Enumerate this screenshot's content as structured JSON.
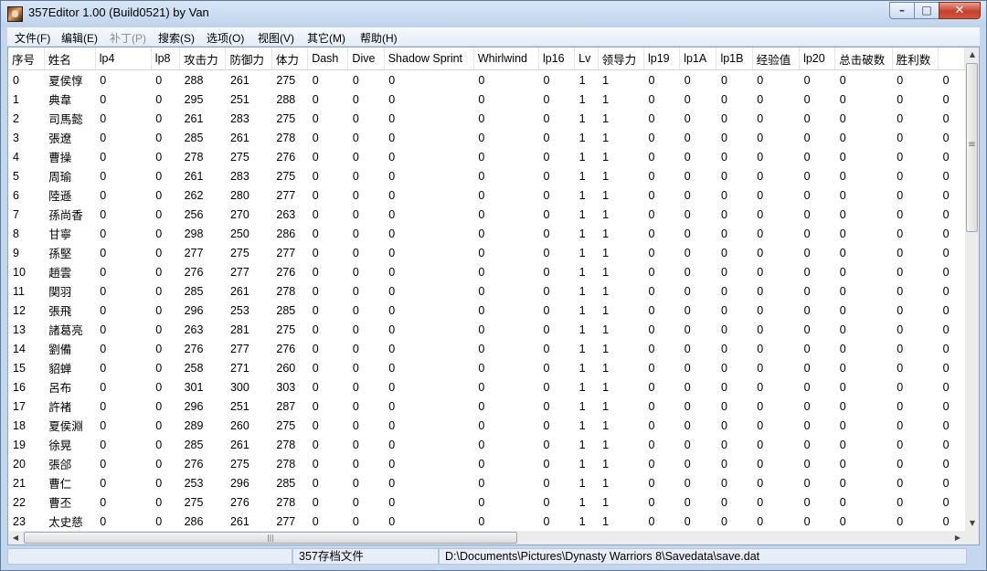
{
  "window": {
    "title": "357Editor 1.00 (Build0521) by Van",
    "minimize_glyph": "–",
    "maximize_glyph": "□",
    "close_glyph": "✕"
  },
  "menu": [
    {
      "label": "文件(F)",
      "enabled": true
    },
    {
      "label": "编辑(E)",
      "enabled": true
    },
    {
      "label": "补丁(P)",
      "enabled": false
    },
    {
      "label": "搜索(S)",
      "enabled": true
    },
    {
      "label": "选项(O)",
      "enabled": true
    },
    {
      "label": "视图(V)",
      "enabled": true
    },
    {
      "label": "其它(M)",
      "enabled": true
    },
    {
      "label": "帮助(H)",
      "enabled": true
    }
  ],
  "table": {
    "columns": [
      "序号",
      "姓名",
      "lp4",
      "lp8",
      "攻击力",
      "防御力",
      "体力",
      "Dash",
      "Dive",
      "Shadow Sprint",
      "Whirlwind",
      "lp16",
      "Lv",
      "领导力",
      "lp19",
      "lp1A",
      "lp1B",
      "经验值",
      "lp20",
      "总击破数",
      "胜利数",
      ""
    ],
    "rows": [
      [
        "0",
        "夏侯惇",
        "0",
        "0",
        "288",
        "261",
        "275",
        "0",
        "0",
        "0",
        "0",
        "0",
        "1",
        "1",
        "0",
        "0",
        "0",
        "0",
        "0",
        "0",
        "0",
        "0"
      ],
      [
        "1",
        "典韋",
        "0",
        "0",
        "295",
        "251",
        "288",
        "0",
        "0",
        "0",
        "0",
        "0",
        "1",
        "1",
        "0",
        "0",
        "0",
        "0",
        "0",
        "0",
        "0",
        "0"
      ],
      [
        "2",
        "司馬懿",
        "0",
        "0",
        "261",
        "283",
        "275",
        "0",
        "0",
        "0",
        "0",
        "0",
        "1",
        "1",
        "0",
        "0",
        "0",
        "0",
        "0",
        "0",
        "0",
        "0"
      ],
      [
        "3",
        "張遼",
        "0",
        "0",
        "285",
        "261",
        "278",
        "0",
        "0",
        "0",
        "0",
        "0",
        "1",
        "1",
        "0",
        "0",
        "0",
        "0",
        "0",
        "0",
        "0",
        "0"
      ],
      [
        "4",
        "曹操",
        "0",
        "0",
        "278",
        "275",
        "276",
        "0",
        "0",
        "0",
        "0",
        "0",
        "1",
        "1",
        "0",
        "0",
        "0",
        "0",
        "0",
        "0",
        "0",
        "0"
      ],
      [
        "5",
        "周瑜",
        "0",
        "0",
        "261",
        "283",
        "275",
        "0",
        "0",
        "0",
        "0",
        "0",
        "1",
        "1",
        "0",
        "0",
        "0",
        "0",
        "0",
        "0",
        "0",
        "0"
      ],
      [
        "6",
        "陸遜",
        "0",
        "0",
        "262",
        "280",
        "277",
        "0",
        "0",
        "0",
        "0",
        "0",
        "1",
        "1",
        "0",
        "0",
        "0",
        "0",
        "0",
        "0",
        "0",
        "0"
      ],
      [
        "7",
        "孫尚香",
        "0",
        "0",
        "256",
        "270",
        "263",
        "0",
        "0",
        "0",
        "0",
        "0",
        "1",
        "1",
        "0",
        "0",
        "0",
        "0",
        "0",
        "0",
        "0",
        "0"
      ],
      [
        "8",
        "甘寧",
        "0",
        "0",
        "298",
        "250",
        "286",
        "0",
        "0",
        "0",
        "0",
        "0",
        "1",
        "1",
        "0",
        "0",
        "0",
        "0",
        "0",
        "0",
        "0",
        "0"
      ],
      [
        "9",
        "孫堅",
        "0",
        "0",
        "277",
        "275",
        "277",
        "0",
        "0",
        "0",
        "0",
        "0",
        "1",
        "1",
        "0",
        "0",
        "0",
        "0",
        "0",
        "0",
        "0",
        "0"
      ],
      [
        "10",
        "趙雲",
        "0",
        "0",
        "276",
        "277",
        "276",
        "0",
        "0",
        "0",
        "0",
        "0",
        "1",
        "1",
        "0",
        "0",
        "0",
        "0",
        "0",
        "0",
        "0",
        "0"
      ],
      [
        "11",
        "関羽",
        "0",
        "0",
        "285",
        "261",
        "278",
        "0",
        "0",
        "0",
        "0",
        "0",
        "1",
        "1",
        "0",
        "0",
        "0",
        "0",
        "0",
        "0",
        "0",
        "0"
      ],
      [
        "12",
        "張飛",
        "0",
        "0",
        "296",
        "253",
        "285",
        "0",
        "0",
        "0",
        "0",
        "0",
        "1",
        "1",
        "0",
        "0",
        "0",
        "0",
        "0",
        "0",
        "0",
        "0"
      ],
      [
        "13",
        "諸葛亮",
        "0",
        "0",
        "263",
        "281",
        "275",
        "0",
        "0",
        "0",
        "0",
        "0",
        "1",
        "1",
        "0",
        "0",
        "0",
        "0",
        "0",
        "0",
        "0",
        "0"
      ],
      [
        "14",
        "劉備",
        "0",
        "0",
        "276",
        "277",
        "276",
        "0",
        "0",
        "0",
        "0",
        "0",
        "1",
        "1",
        "0",
        "0",
        "0",
        "0",
        "0",
        "0",
        "0",
        "0"
      ],
      [
        "15",
        "貂蝉",
        "0",
        "0",
        "258",
        "271",
        "260",
        "0",
        "0",
        "0",
        "0",
        "0",
        "1",
        "1",
        "0",
        "0",
        "0",
        "0",
        "0",
        "0",
        "0",
        "0"
      ],
      [
        "16",
        "呂布",
        "0",
        "0",
        "301",
        "300",
        "303",
        "0",
        "0",
        "0",
        "0",
        "0",
        "1",
        "1",
        "0",
        "0",
        "0",
        "0",
        "0",
        "0",
        "0",
        "0"
      ],
      [
        "17",
        "許褚",
        "0",
        "0",
        "296",
        "251",
        "287",
        "0",
        "0",
        "0",
        "0",
        "0",
        "1",
        "1",
        "0",
        "0",
        "0",
        "0",
        "0",
        "0",
        "0",
        "0"
      ],
      [
        "18",
        "夏侯淵",
        "0",
        "0",
        "289",
        "260",
        "275",
        "0",
        "0",
        "0",
        "0",
        "0",
        "1",
        "1",
        "0",
        "0",
        "0",
        "0",
        "0",
        "0",
        "0",
        "0"
      ],
      [
        "19",
        "徐晃",
        "0",
        "0",
        "285",
        "261",
        "278",
        "0",
        "0",
        "0",
        "0",
        "0",
        "1",
        "1",
        "0",
        "0",
        "0",
        "0",
        "0",
        "0",
        "0",
        "0"
      ],
      [
        "20",
        "張郃",
        "0",
        "0",
        "276",
        "275",
        "278",
        "0",
        "0",
        "0",
        "0",
        "0",
        "1",
        "1",
        "0",
        "0",
        "0",
        "0",
        "0",
        "0",
        "0",
        "0"
      ],
      [
        "21",
        "曹仁",
        "0",
        "0",
        "253",
        "296",
        "285",
        "0",
        "0",
        "0",
        "0",
        "0",
        "1",
        "1",
        "0",
        "0",
        "0",
        "0",
        "0",
        "0",
        "0",
        "0"
      ],
      [
        "22",
        "曹丕",
        "0",
        "0",
        "275",
        "276",
        "278",
        "0",
        "0",
        "0",
        "0",
        "0",
        "1",
        "1",
        "0",
        "0",
        "0",
        "0",
        "0",
        "0",
        "0",
        "0"
      ],
      [
        "23",
        "太史慈",
        "0",
        "0",
        "286",
        "261",
        "277",
        "0",
        "0",
        "0",
        "0",
        "0",
        "1",
        "1",
        "0",
        "0",
        "0",
        "0",
        "0",
        "0",
        "0",
        "0"
      ]
    ]
  },
  "scrollbars": {
    "up_arrow": "▲",
    "down_arrow": "▼",
    "left_arrow": "◀",
    "right_arrow": "▶"
  },
  "status": {
    "cell1": "",
    "file_type": "357存档文件",
    "file_path": "D:\\Documents\\Pictures\\Dynasty Warriors 8\\Savedata\\save.dat"
  }
}
